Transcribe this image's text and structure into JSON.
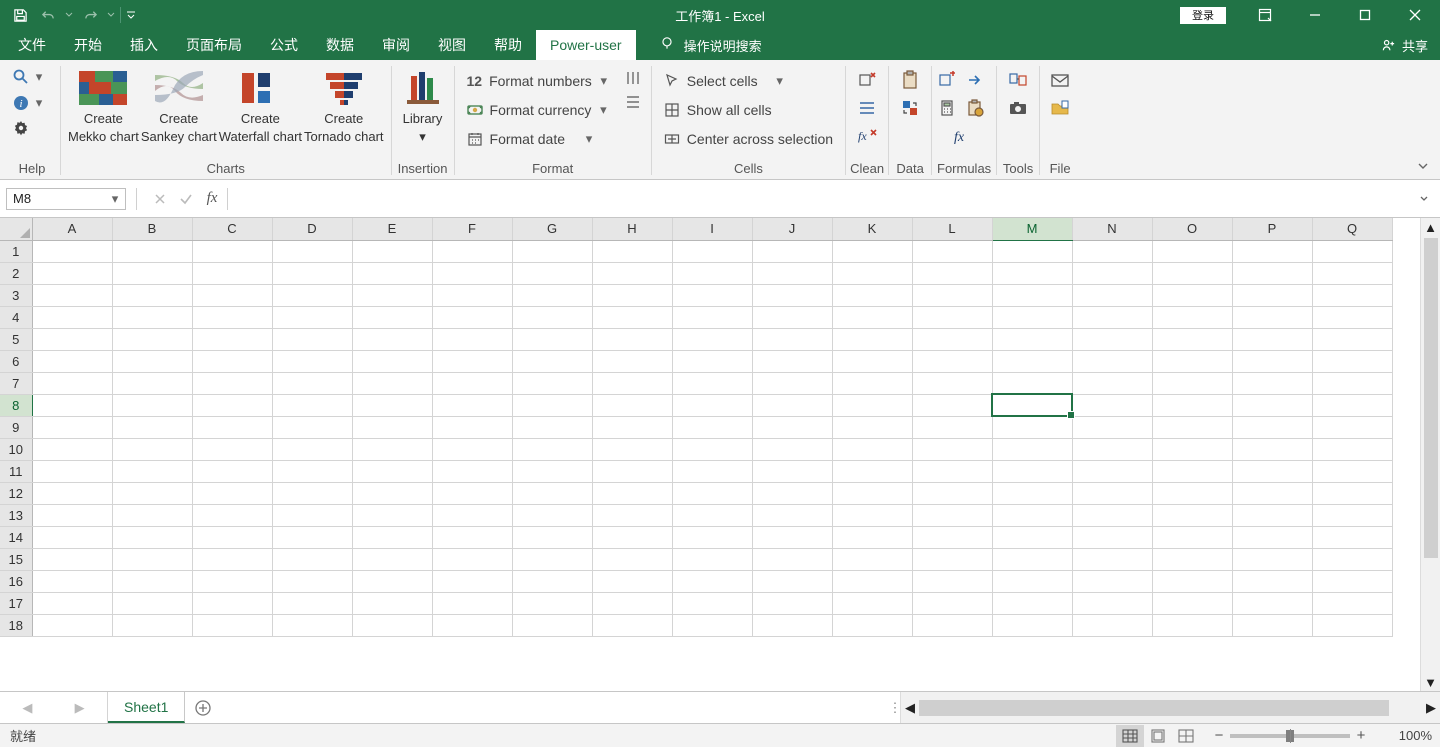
{
  "title": "工作簿1 - Excel",
  "qat": {
    "save": "save-icon",
    "undo": "undo-icon",
    "redo": "redo-icon"
  },
  "login_label": "登录",
  "tabs": [
    "文件",
    "开始",
    "插入",
    "页面布局",
    "公式",
    "数据",
    "审阅",
    "视图",
    "帮助",
    "Power-user"
  ],
  "active_tab_index": 9,
  "tell_me": "操作说明搜索",
  "share": "共享",
  "ribbon": {
    "help_group": {
      "label": "Help"
    },
    "charts_group": {
      "label": "Charts",
      "mekko": {
        "l1": "Create",
        "l2": "Mekko chart"
      },
      "sankey": {
        "l1": "Create",
        "l2": "Sankey chart"
      },
      "waterfall": {
        "l1": "Create",
        "l2": "Waterfall chart"
      },
      "tornado": {
        "l1": "Create",
        "l2": "Tornado chart"
      }
    },
    "insertion_group": {
      "label": "Insertion",
      "library": {
        "l1": "Library"
      }
    },
    "format_group": {
      "label": "Format",
      "num_prefix": "12",
      "numbers": "Format numbers",
      "currency": "Format currency",
      "date": "Format date"
    },
    "cells_group": {
      "label": "Cells",
      "select": "Select cells",
      "showall": "Show all cells",
      "center": "Center across selection"
    },
    "clean_group": {
      "label": "Clean"
    },
    "data_group": {
      "label": "Data"
    },
    "formulas_group": {
      "label": "Formulas"
    },
    "tools_group": {
      "label": "Tools"
    },
    "file_group": {
      "label": "File"
    }
  },
  "name_box": "M8",
  "formula_input": "",
  "columns": [
    "A",
    "B",
    "C",
    "D",
    "E",
    "F",
    "G",
    "H",
    "I",
    "J",
    "K",
    "L",
    "M",
    "N",
    "O",
    "P",
    "Q"
  ],
  "rows": [
    1,
    2,
    3,
    4,
    5,
    6,
    7,
    8,
    9,
    10,
    11,
    12,
    13,
    14,
    15,
    16,
    17,
    18
  ],
  "selected_col": "M",
  "selected_row": 8,
  "sheet_tabs": [
    "Sheet1"
  ],
  "status_text": "就绪",
  "zoom": "100%"
}
